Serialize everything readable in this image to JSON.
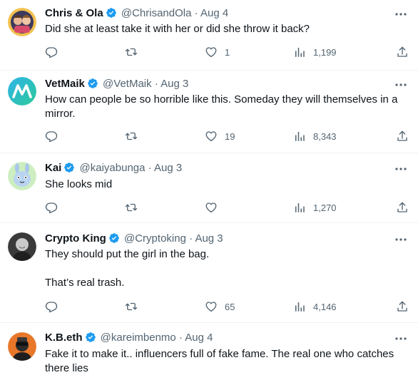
{
  "colors": {
    "text": "#0f1419",
    "secondary": "#536471",
    "verified": "#1d9bf0",
    "divider": "#eff3f4"
  },
  "tweets": [
    {
      "name": "Chris & Ola",
      "handle": "@ChrisandOla",
      "sep": "·",
      "date": "Aug 4",
      "verified": true,
      "lines": [
        "Did she at least take it with her or did she throw it back?"
      ],
      "replies": "",
      "retweets": "",
      "likes": "1",
      "views": "1,199"
    },
    {
      "name": "VetMaik",
      "handle": "@VetMaik",
      "sep": "·",
      "date": "Aug 3",
      "verified": true,
      "lines": [
        "How can people be so horrible like this. Someday they will themselves in a mirror."
      ],
      "replies": "",
      "retweets": "",
      "likes": "19",
      "views": "8,343"
    },
    {
      "name": "Kai",
      "handle": "@kaiyabunga",
      "sep": "·",
      "date": "Aug 3",
      "verified": true,
      "lines": [
        "She looks mid"
      ],
      "replies": "",
      "retweets": "",
      "likes": "",
      "views": "1,270"
    },
    {
      "name": "Crypto King",
      "handle": "@Cryptoking",
      "sep": "·",
      "date": "Aug 3",
      "verified": true,
      "lines": [
        "They should put the girl in the bag.",
        "That’s real trash."
      ],
      "replies": "",
      "retweets": "",
      "likes": "65",
      "views": "4,146"
    },
    {
      "name": "K.B.eth",
      "handle": "@kareimbenmo",
      "sep": "·",
      "date": "Aug 4",
      "verified": true,
      "lines": [
        "Fake it to make it.. influencers full of fake fame.  The real one who catches there lies"
      ]
    }
  ]
}
